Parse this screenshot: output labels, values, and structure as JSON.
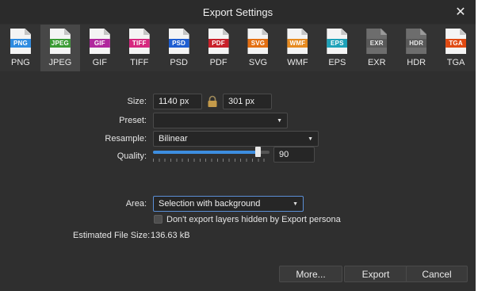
{
  "window": {
    "title": "Export Settings"
  },
  "formats": [
    {
      "label": "PNG",
      "badge": "PNG",
      "color": "#2e8be0",
      "selected": false,
      "dark": false
    },
    {
      "label": "JPEG",
      "badge": "JPEG",
      "color": "#3a9b34",
      "selected": true,
      "dark": false
    },
    {
      "label": "GIF",
      "badge": "GIF",
      "color": "#b0279d",
      "selected": false,
      "dark": false
    },
    {
      "label": "TIFF",
      "badge": "TIFF",
      "color": "#d6287f",
      "selected": false,
      "dark": false
    },
    {
      "label": "PSD",
      "badge": "PSD",
      "color": "#1e5ed1",
      "selected": false,
      "dark": false
    },
    {
      "label": "PDF",
      "badge": "PDF",
      "color": "#c8202a",
      "selected": false,
      "dark": false
    },
    {
      "label": "SVG",
      "badge": "SVG",
      "color": "#e36f12",
      "selected": false,
      "dark": false
    },
    {
      "label": "WMF",
      "badge": "WMF",
      "color": "#e68a1f",
      "selected": false,
      "dark": false
    },
    {
      "label": "EPS",
      "badge": "EPS",
      "color": "#1ea1b8",
      "selected": false,
      "dark": false
    },
    {
      "label": "EXR",
      "badge": "EXR",
      "color": "#595959",
      "selected": false,
      "dark": true
    },
    {
      "label": "HDR",
      "badge": "HDR",
      "color": "#595959",
      "selected": false,
      "dark": true
    },
    {
      "label": "TGA",
      "badge": "TGA",
      "color": "#e04a12",
      "selected": false,
      "dark": false
    }
  ],
  "settings": {
    "size_label": "Size:",
    "width_value": "1140 px",
    "height_value": "301 px",
    "preset_label": "Preset:",
    "preset_value": "",
    "resample_label": "Resample:",
    "resample_value": "Bilinear",
    "quality_label": "Quality:",
    "quality_value": "90",
    "quality_level": 0.9,
    "area_label": "Area:",
    "area_value": "Selection with background",
    "hidden_layers_label": "Don't export layers hidden by Export persona",
    "hidden_layers_checked": false,
    "filesize_label": "Estimated File Size:",
    "filesize_value": "136.63 kB"
  },
  "buttons": {
    "more": "More...",
    "export": "Export",
    "cancel": "Cancel"
  },
  "colors": {
    "accent": "#3d8ee0",
    "background": "#2f2f2f"
  }
}
